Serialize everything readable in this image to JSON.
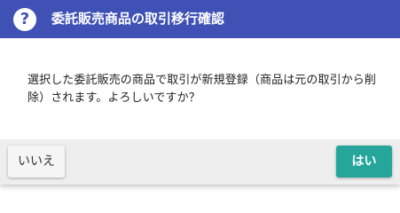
{
  "dialog": {
    "title": "委託販売商品の取引移行確認",
    "message": "選択した委託販売の商品で取引が新規登録（商品は元の取引から削除）されます。よろしいですか？",
    "no_label": "いいえ",
    "yes_label": "はい",
    "icon": "question-circle-icon"
  },
  "colors": {
    "header_bg": "#3f51b5",
    "yes_button_bg": "#26a69a",
    "footer_bg": "#eeeeee"
  }
}
